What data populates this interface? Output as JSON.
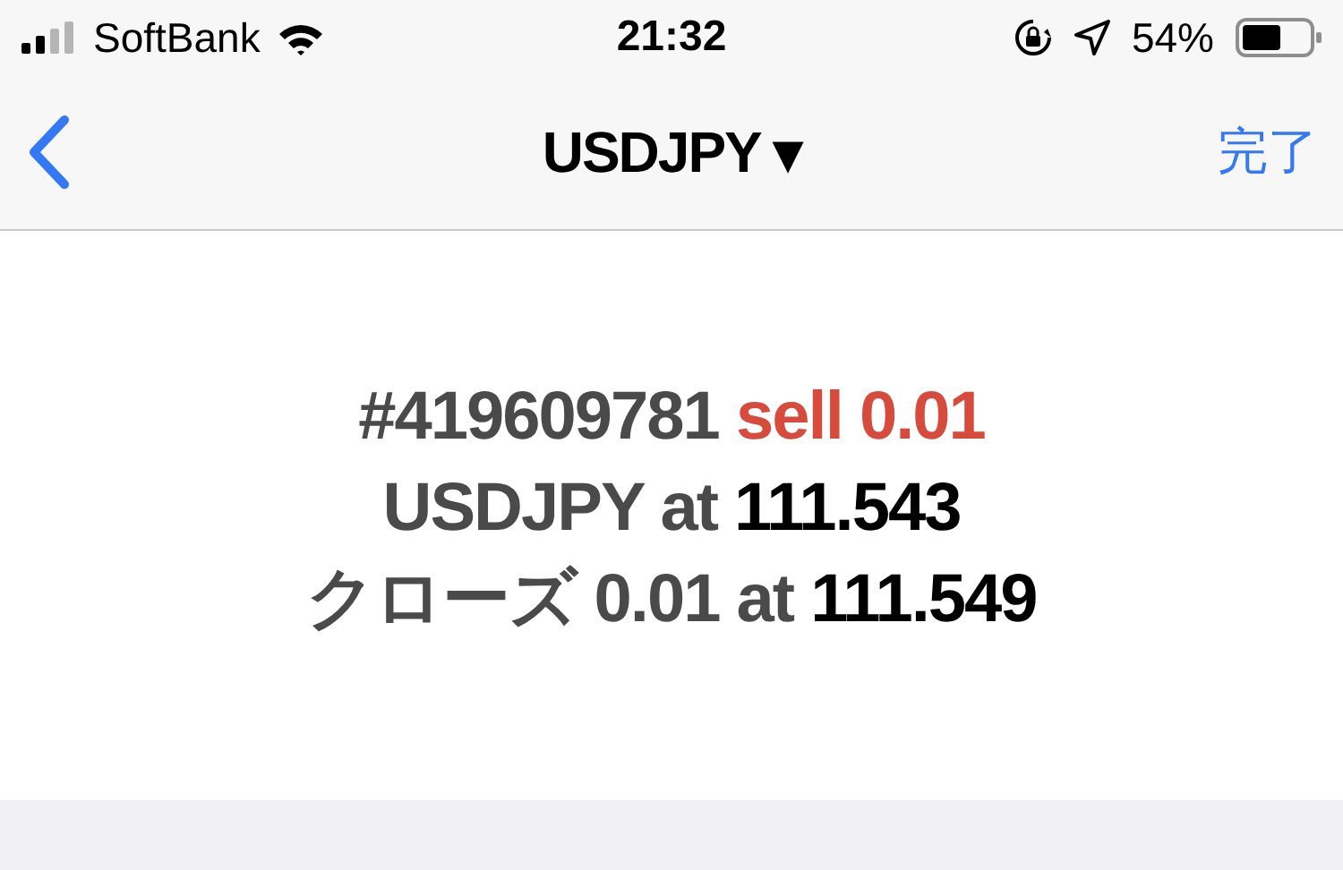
{
  "status_bar": {
    "carrier": "SoftBank",
    "time": "21:32",
    "battery": "54%"
  },
  "nav_bar": {
    "title": "USDJPY ▾",
    "done": "完了"
  },
  "order_lines": [
    {
      "segments": [
        {
          "kind": "plain",
          "text": "#419609781 "
        },
        {
          "kind": "sell",
          "text": "sell 0.01"
        }
      ]
    },
    {
      "segments": [
        {
          "kind": "plain",
          "text": "USDJPY at "
        },
        {
          "kind": "price",
          "text": "111.543"
        }
      ]
    },
    {
      "segments": [
        {
          "kind": "plain",
          "text": "クローズ 0.01 at "
        },
        {
          "kind": "price",
          "text": "111.549"
        }
      ]
    }
  ]
}
